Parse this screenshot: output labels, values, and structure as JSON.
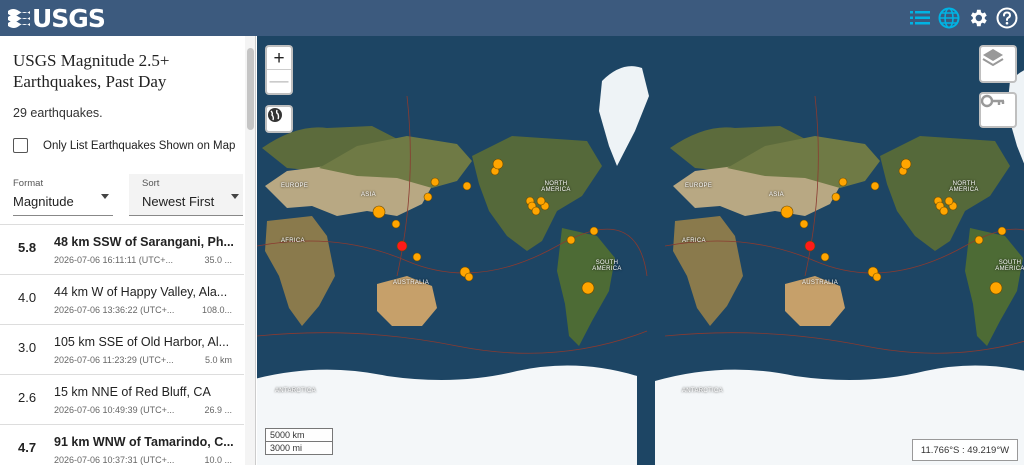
{
  "header": {
    "logo_text": "USGS",
    "colors": {
      "background": "#3c5a7e",
      "accent": "#00b3e3",
      "icon": "#ffffff"
    },
    "icons": [
      "list-icon",
      "globe-icon",
      "gear-icon",
      "help-icon"
    ]
  },
  "sidebar": {
    "title": "USGS Magnitude 2.5+ Earthquakes, Past Day",
    "count_text": "29 earthquakes.",
    "only_list_label": "Only List Earthquakes Shown on Map",
    "only_list_checked": false,
    "format": {
      "caption": "Format",
      "value": "Magnitude"
    },
    "sort": {
      "caption": "Sort",
      "value": "Newest First"
    }
  },
  "earthquakes": [
    {
      "mag": "5.8",
      "place": "48 km SSW of Sarangani, Ph...",
      "time": "2026-07-06 16:11:11 (UTC+...",
      "depth": "35.0 ..."
    },
    {
      "mag": "4.0",
      "place": "44 km W of Happy Valley, Ala...",
      "time": "2026-07-06 13:36:22 (UTC+...",
      "depth": "108.0..."
    },
    {
      "mag": "3.0",
      "place": "105 km SSE of Old Harbor, Al...",
      "time": "2026-07-06 11:23:29 (UTC+...",
      "depth": "5.0 km"
    },
    {
      "mag": "2.6",
      "place": "15 km NNE of Red Bluff, CA",
      "time": "2026-07-06 10:49:39 (UTC+...",
      "depth": "26.9 ..."
    },
    {
      "mag": "4.7",
      "place": "91 km WNW of Tamarindo, C...",
      "time": "2026-07-06 10:37:31 (UTC+...",
      "depth": "10.0 ..."
    }
  ],
  "map": {
    "zoom_in": "+",
    "zoom_out": "—",
    "labels": {
      "europe": "EUROPE",
      "asia": "ASIA",
      "africa": "AFRICA",
      "australia": "AUSTRALIA",
      "north_america": "NORTH AMERICA",
      "south_america": "SOUTH AMERICA",
      "antarctica": "ANTARCTICA"
    },
    "scale_km": "5000 km",
    "scale_mi": "3000 mi",
    "coordinates": "11.766°S : 49.219°W",
    "marker_colors": {
      "significant": "#ff1a1a",
      "normal": "#ffa500",
      "outline": "#6b4a00"
    }
  }
}
